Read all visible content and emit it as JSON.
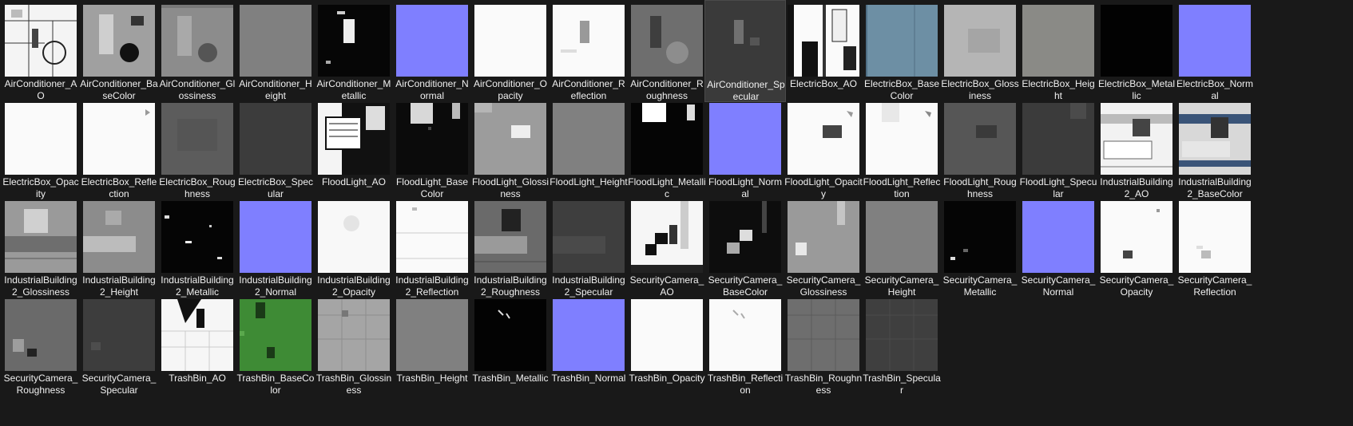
{
  "files": [
    {
      "name": "AirConditioner_AO",
      "tex": "ac_ao"
    },
    {
      "name": "AirConditioner_BaseColor",
      "tex": "ac_base"
    },
    {
      "name": "AirConditioner_Glossiness",
      "tex": "ac_gloss"
    },
    {
      "name": "AirConditioner_Height",
      "tex": "flat_gray"
    },
    {
      "name": "AirConditioner_Metallic",
      "tex": "ac_metal"
    },
    {
      "name": "AirConditioner_Normal",
      "tex": "normal"
    },
    {
      "name": "AirConditioner_Opacity",
      "tex": "white"
    },
    {
      "name": "AirConditioner_Reflection",
      "tex": "ac_refl"
    },
    {
      "name": "AirConditioner_Roughness",
      "tex": "ac_rough"
    },
    {
      "name": "AirConditioner_Specular",
      "tex": "ac_spec",
      "selected": true
    },
    {
      "name": "ElectricBox_AO",
      "tex": "eb_ao"
    },
    {
      "name": "ElectricBox_BaseColor",
      "tex": "eb_base"
    },
    {
      "name": "ElectricBox_Glossiness",
      "tex": "eb_gloss"
    },
    {
      "name": "ElectricBox_Height",
      "tex": "flat_gray2"
    },
    {
      "name": "ElectricBox_Metallic",
      "tex": "black"
    },
    {
      "name": "ElectricBox_Normal",
      "tex": "normal"
    },
    {
      "name": "ElectricBox_Opacity",
      "tex": "white"
    },
    {
      "name": "ElectricBox_Reflection",
      "tex": "eb_refl"
    },
    {
      "name": "ElectricBox_Roughness",
      "tex": "eb_rough"
    },
    {
      "name": "ElectricBox_Specular",
      "tex": "eb_spec"
    },
    {
      "name": "FloodLight_AO",
      "tex": "fl_ao"
    },
    {
      "name": "FloodLight_BaseColor",
      "tex": "fl_base"
    },
    {
      "name": "FloodLight_Glossiness",
      "tex": "fl_gloss"
    },
    {
      "name": "FloodLight_Height",
      "tex": "flat_gray"
    },
    {
      "name": "FloodLight_Metallic",
      "tex": "fl_metal"
    },
    {
      "name": "FloodLight_Normal",
      "tex": "normal"
    },
    {
      "name": "FloodLight_Opacity",
      "tex": "fl_opac"
    },
    {
      "name": "FloodLight_Reflection",
      "tex": "fl_refl"
    },
    {
      "name": "FloodLight_Roughness",
      "tex": "fl_rough"
    },
    {
      "name": "FloodLight_Specular",
      "tex": "fl_spec"
    },
    {
      "name": "IndustrialBuilding2_AO",
      "tex": "ib_ao"
    },
    {
      "name": "IndustrialBuilding2_BaseColor",
      "tex": "ib_base"
    },
    {
      "name": "IndustrialBuilding2_Glossiness",
      "tex": "ib_gloss"
    },
    {
      "name": "IndustrialBuilding2_Height",
      "tex": "ib_height"
    },
    {
      "name": "IndustrialBuilding2_Metallic",
      "tex": "ib_metal"
    },
    {
      "name": "IndustrialBuilding2_Normal",
      "tex": "normal"
    },
    {
      "name": "IndustrialBuilding2_Opacity",
      "tex": "ib_opac"
    },
    {
      "name": "IndustrialBuilding2_Reflection",
      "tex": "ib_refl"
    },
    {
      "name": "IndustrialBuilding2_Roughness",
      "tex": "ib_rough"
    },
    {
      "name": "IndustrialBuilding2_Specular",
      "tex": "ib_spec"
    },
    {
      "name": "SecurityCamera_AO",
      "tex": "sc_ao"
    },
    {
      "name": "SecurityCamera_BaseColor",
      "tex": "sc_base"
    },
    {
      "name": "SecurityCamera_Glossiness",
      "tex": "sc_gloss"
    },
    {
      "name": "SecurityCamera_Height",
      "tex": "flat_gray"
    },
    {
      "name": "SecurityCamera_Metallic",
      "tex": "sc_metal"
    },
    {
      "name": "SecurityCamera_Normal",
      "tex": "normal"
    },
    {
      "name": "SecurityCamera_Opacity",
      "tex": "sc_opac"
    },
    {
      "name": "SecurityCamera_Reflection",
      "tex": "sc_refl"
    },
    {
      "name": "SecurityCamera_Roughness",
      "tex": "sc_rough"
    },
    {
      "name": "SecurityCamera_Specular",
      "tex": "sc_spec"
    },
    {
      "name": "TrashBin_AO",
      "tex": "tb_ao"
    },
    {
      "name": "TrashBin_BaseColor",
      "tex": "tb_base"
    },
    {
      "name": "TrashBin_Glossiness",
      "tex": "tb_gloss"
    },
    {
      "name": "TrashBin_Height",
      "tex": "flat_gray"
    },
    {
      "name": "TrashBin_Metallic",
      "tex": "tb_metal"
    },
    {
      "name": "TrashBin_Normal",
      "tex": "normal"
    },
    {
      "name": "TrashBin_Opacity",
      "tex": "white"
    },
    {
      "name": "TrashBin_Reflection",
      "tex": "tb_refl"
    },
    {
      "name": "TrashBin_Roughness",
      "tex": "tb_rough"
    },
    {
      "name": "TrashBin_Specular",
      "tex": "tb_spec"
    }
  ],
  "colors": {
    "background": "#191919",
    "selection": "#3a3a3a",
    "label": "#f0f0f0",
    "normal_map": "#7f7fff",
    "trashbin_green": "#3e8b35",
    "electricbox_blue": "#6d8fa4"
  }
}
